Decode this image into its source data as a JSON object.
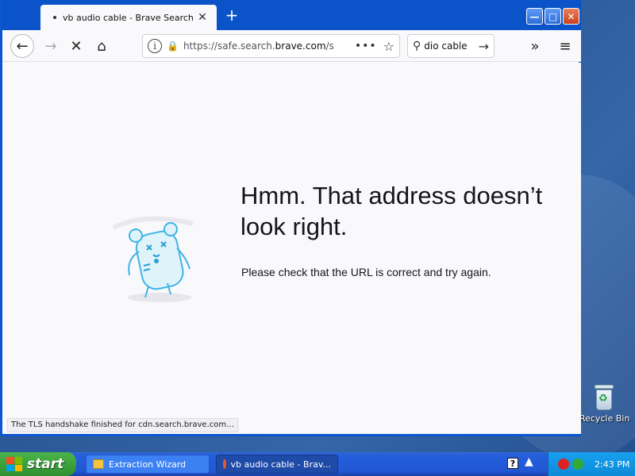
{
  "tab": {
    "title": "vb audio cable - Brave Search",
    "close": "✕"
  },
  "newtab_label": "+",
  "window_buttons": {
    "minimize": "—",
    "maximize": "□",
    "close": "✕"
  },
  "nav": {
    "back": "←",
    "forward": "→",
    "stop": "✕",
    "home": "⌂",
    "overflow": "»",
    "menu": "≡"
  },
  "urlbar": {
    "prefix": "https://safe.search.",
    "domain": "brave.com",
    "suffix": "/s",
    "more": "•••",
    "star": "☆",
    "info": "i",
    "lock": "🔒"
  },
  "searchbox": {
    "icon": "⚲",
    "text": "dio cable",
    "go": "→"
  },
  "error": {
    "title": "Hmm. That address doesn’t look right.",
    "message": "Please check that the URL is correct and try again."
  },
  "status_text": "The TLS handshake finished for cdn.search.brave.com…",
  "desktop": {
    "recycle_bin": "Recycle Bin"
  },
  "taskbar": {
    "start": "start",
    "tasks": [
      {
        "label": "Extraction Wizard"
      },
      {
        "label": "vb audio cable - Brav..."
      }
    ],
    "help": "?",
    "clock": "2:43 PM"
  }
}
